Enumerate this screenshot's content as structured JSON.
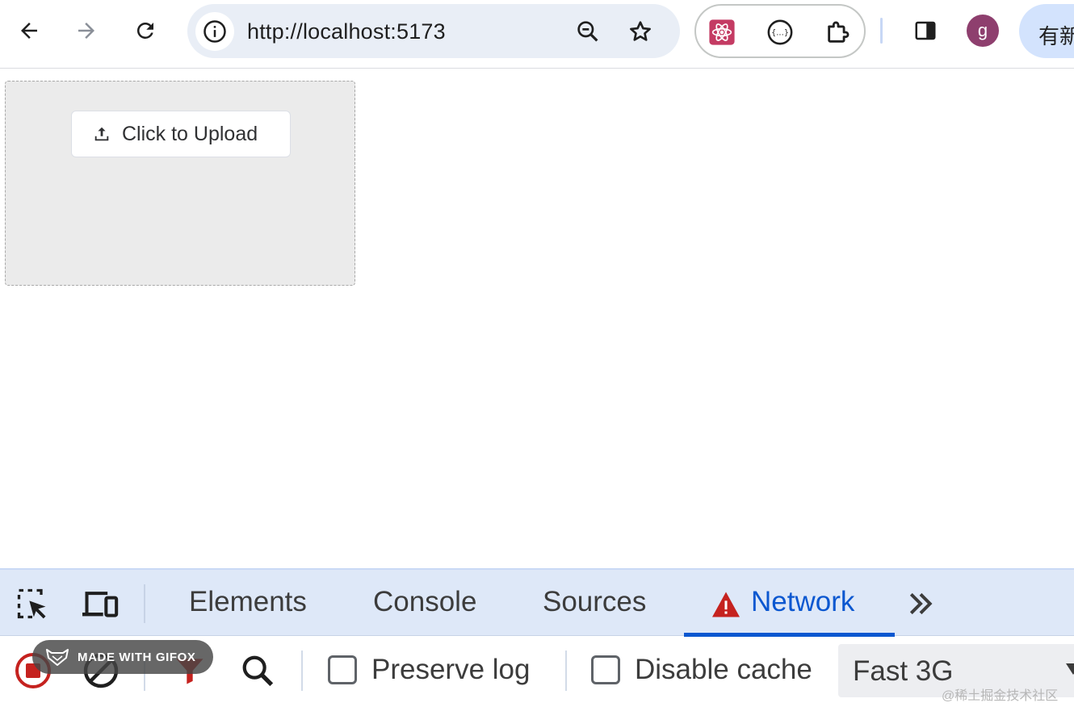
{
  "browser": {
    "url": "http://localhost:5173",
    "update_label": "有新",
    "avatar_letter": "g"
  },
  "page": {
    "upload_button_label": "Click to Upload"
  },
  "devtools": {
    "tabs": [
      {
        "label": "Elements",
        "active": false
      },
      {
        "label": "Console",
        "active": false
      },
      {
        "label": "Sources",
        "active": false
      },
      {
        "label": "Network",
        "active": true,
        "warning_icon": true
      }
    ],
    "toolbar": {
      "preserve_log_label": "Preserve log",
      "preserve_log_checked": false,
      "disable_cache_label": "Disable cache",
      "disable_cache_checked": false,
      "throttling_value": "Fast 3G"
    }
  },
  "overlays": {
    "gifox_badge": "MADE WITH GIFOX",
    "watermark": "@稀土掘金技术社区"
  },
  "colors": {
    "accent": "#0b57d0",
    "recording": "#c5221f",
    "warning": "#c5221f",
    "omnibox_bg": "#e9eef6",
    "devtools_tabs_bg": "#dee8f8"
  }
}
